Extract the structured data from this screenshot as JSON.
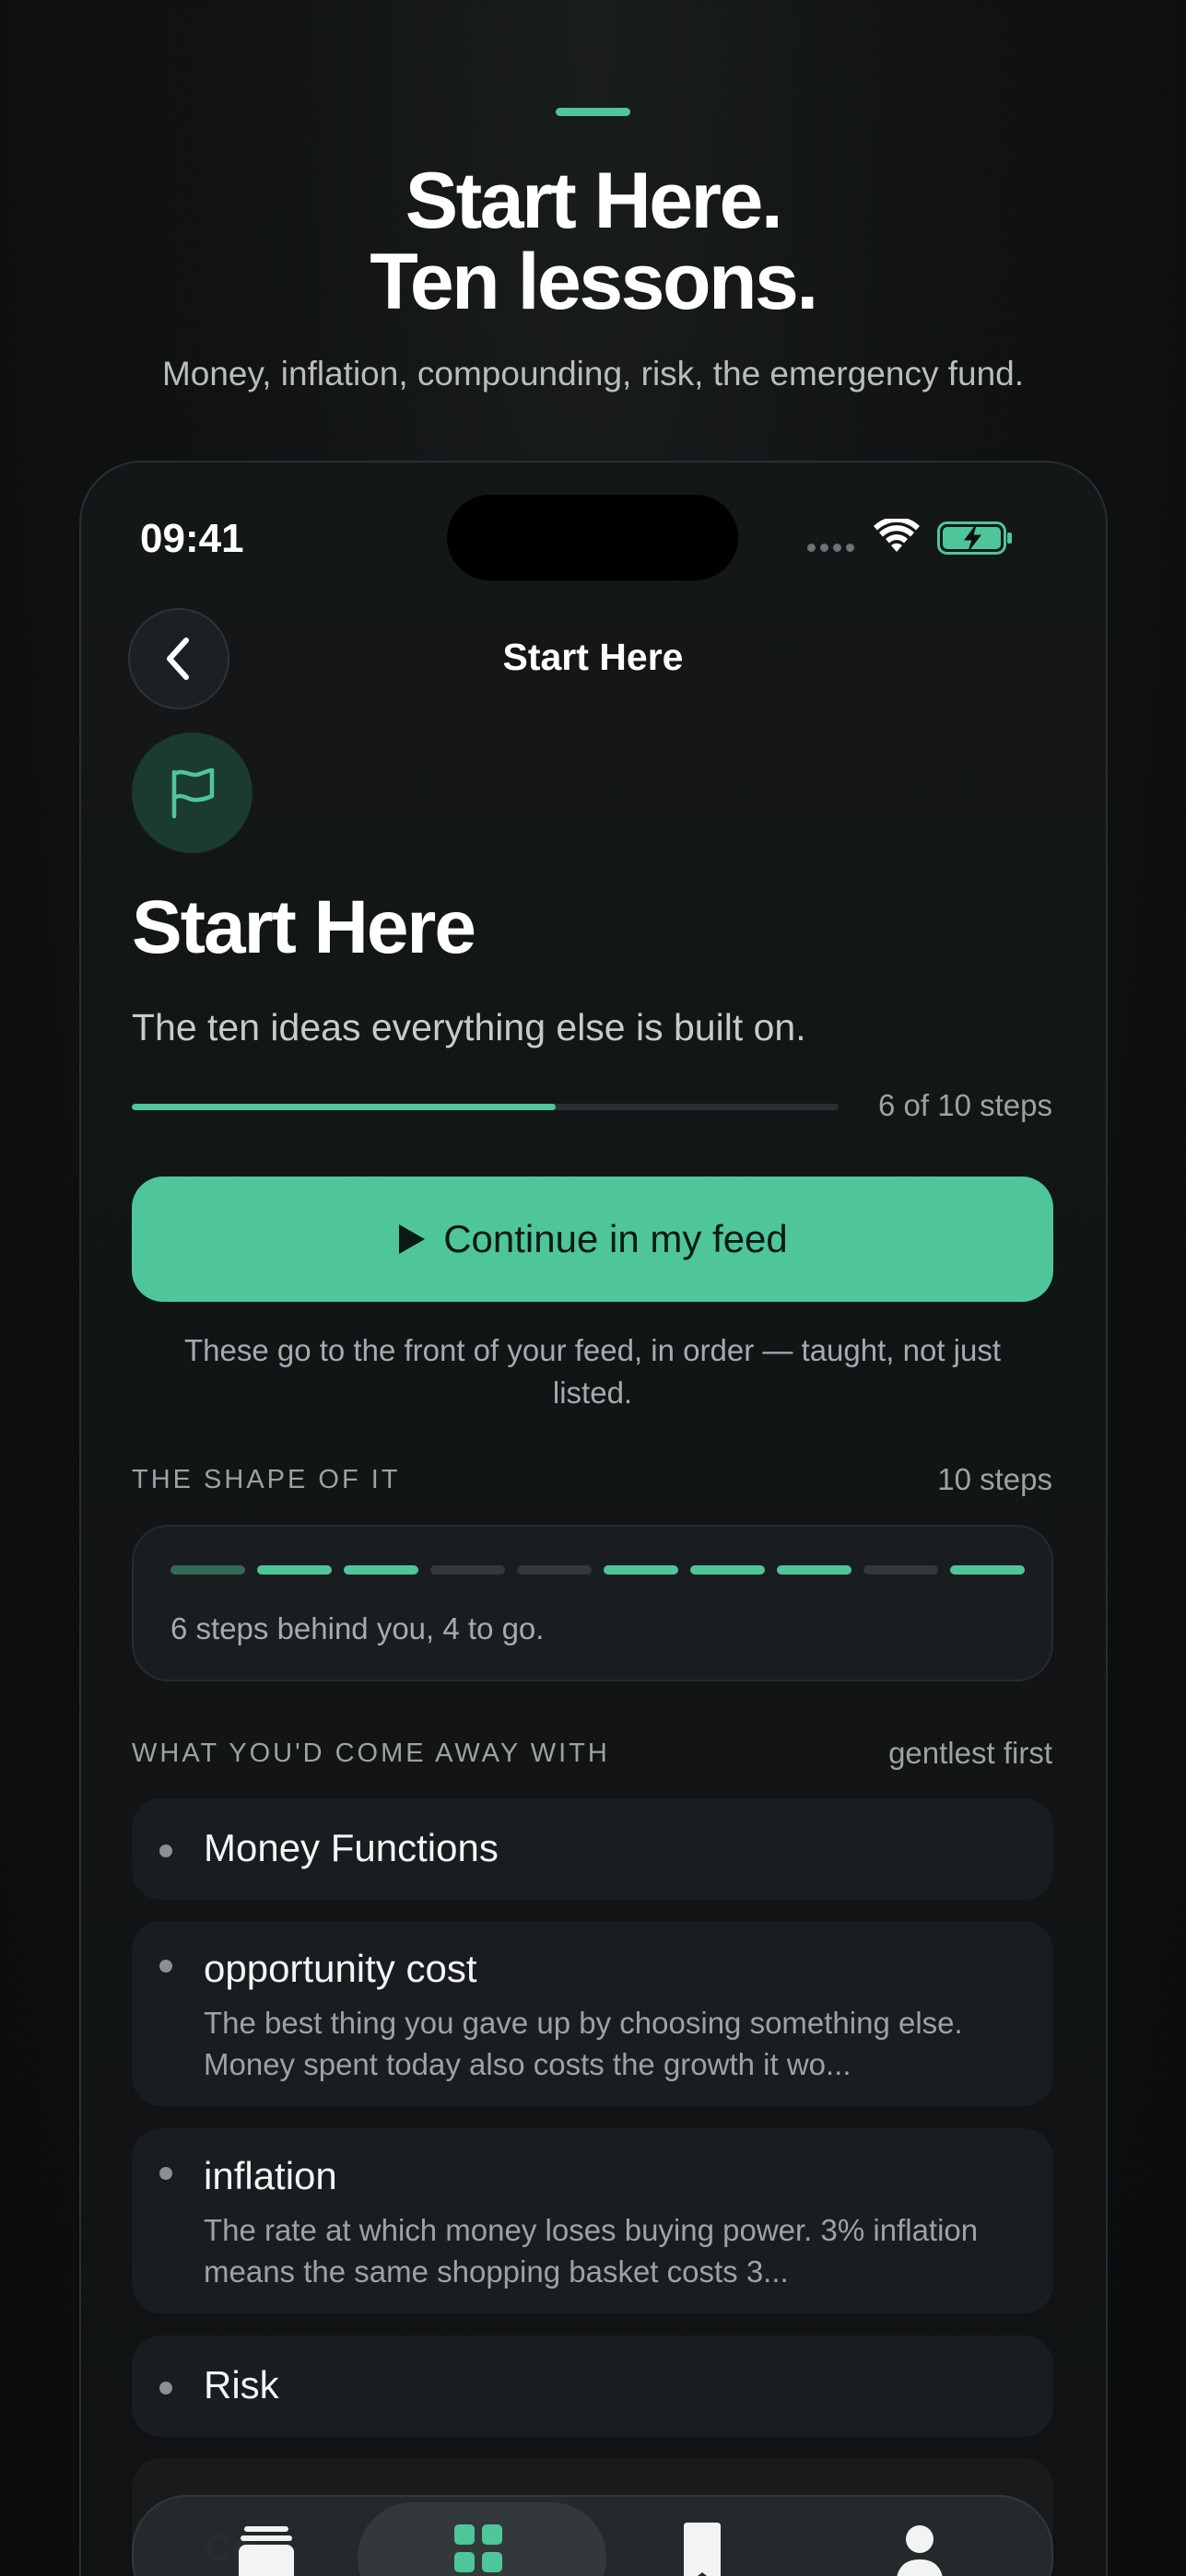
{
  "hero": {
    "title_line1": "Start Here.",
    "title_line2": "Ten lessons.",
    "subtitle": "Money, inflation, compounding, risk, the emergency fund."
  },
  "status_bar": {
    "time": "09:41",
    "battery_color": "#4fc59a"
  },
  "nav": {
    "back_icon": "chevron-left-icon",
    "title": "Start Here"
  },
  "header": {
    "icon": "flag-icon",
    "title": "Start Here",
    "subtitle": "The ten ideas everything else is built on."
  },
  "progress": {
    "completed": 6,
    "total": 10,
    "label": "6 of 10 steps"
  },
  "cta": {
    "icon": "play-icon",
    "label": "Continue in my feed",
    "note": "These go to the front of your feed, in order — taught, not just listed."
  },
  "shape_section": {
    "label": "THE SHAPE OF IT",
    "count": "10 steps",
    "segments": [
      "current",
      "done",
      "done",
      "todo",
      "todo",
      "done",
      "done",
      "done",
      "todo",
      "done"
    ],
    "summary": "6 steps behind you, 4 to go."
  },
  "outcomes_section": {
    "label": "WHAT YOU'D COME AWAY WITH",
    "sort": "gentlest first",
    "items": [
      {
        "title": "Money Functions",
        "desc": ""
      },
      {
        "title": "opportunity cost",
        "desc": "The best thing you gave up by choosing something else. Money spent today also costs the growth it wo..."
      },
      {
        "title": "inflation",
        "desc": "The rate at which money loses buying power. 3% inflation means the same shopping basket costs 3..."
      },
      {
        "title": "Risk",
        "desc": ""
      }
    ],
    "partial_item_text": "Co"
  },
  "tabbar": {
    "tabs": [
      "stack-icon",
      "grid-icon",
      "bookmark-icon",
      "profile-icon"
    ],
    "active": "grid-icon"
  },
  "colors": {
    "accent": "#4fc59a",
    "background": "#0f1112",
    "card": "#1a1d1f"
  }
}
